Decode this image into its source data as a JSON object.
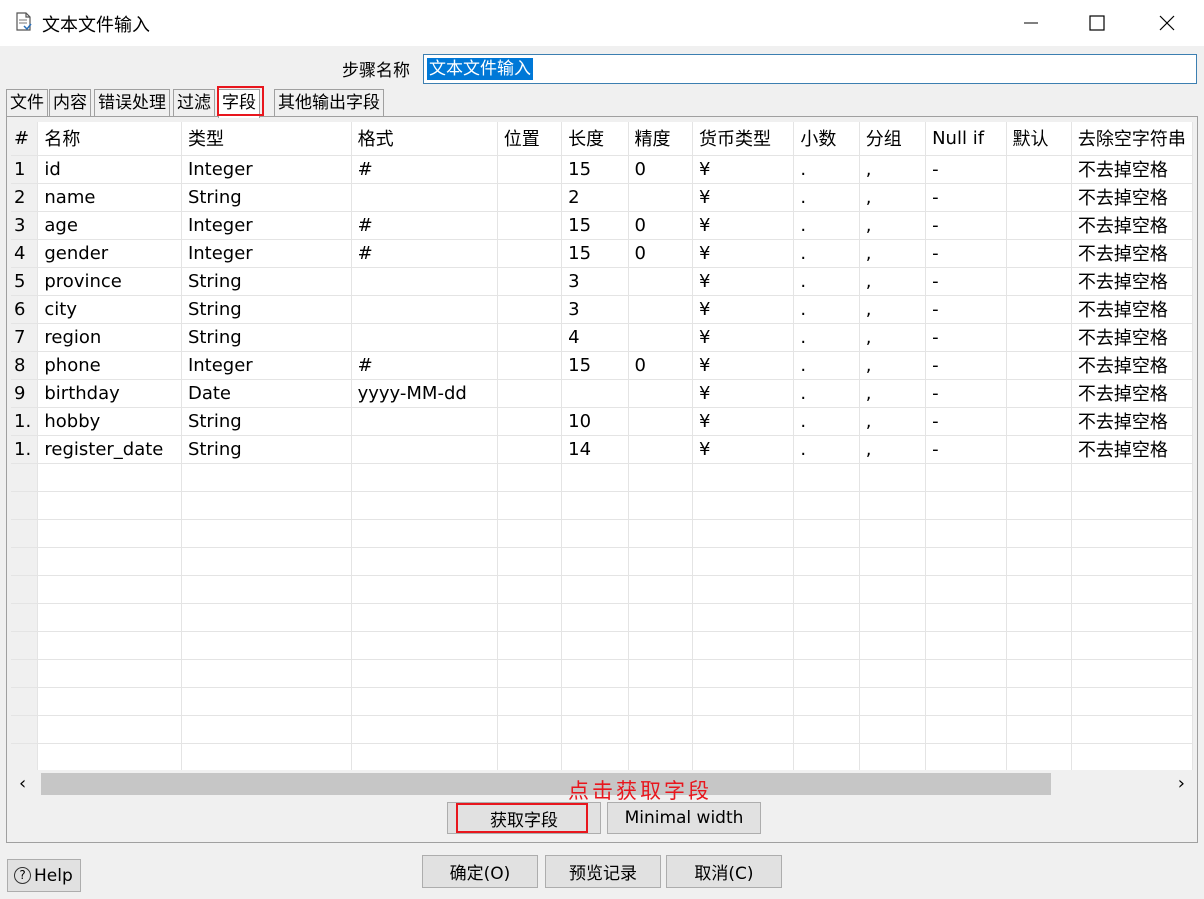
{
  "window": {
    "title": "文本文件输入"
  },
  "step": {
    "label": "步骤名称",
    "value": "文本文件输入"
  },
  "tabs": [
    {
      "label": "文件"
    },
    {
      "label": "内容"
    },
    {
      "label": "错误处理"
    },
    {
      "label": "过滤"
    },
    {
      "label": "字段"
    },
    {
      "label": "其他输出字段"
    }
  ],
  "active_tab": "字段",
  "grid": {
    "columns": [
      "#",
      "名称",
      "类型",
      "格式",
      "位置",
      "长度",
      "精度",
      "货币类型",
      "小数",
      "分组",
      "Null if",
      "默认",
      "去除空字符串"
    ],
    "rows": [
      [
        "1",
        "id",
        "Integer",
        "#",
        "",
        "15",
        "0",
        "¥",
        ".",
        ",",
        "-",
        "",
        "不去掉空格"
      ],
      [
        "2",
        "name",
        "String",
        "",
        "",
        "2",
        "",
        "¥",
        ".",
        ",",
        "-",
        "",
        "不去掉空格"
      ],
      [
        "3",
        "age",
        "Integer",
        "#",
        "",
        "15",
        "0",
        "¥",
        ".",
        ",",
        "-",
        "",
        "不去掉空格"
      ],
      [
        "4",
        "gender",
        "Integer",
        "#",
        "",
        "15",
        "0",
        "¥",
        ".",
        ",",
        "-",
        "",
        "不去掉空格"
      ],
      [
        "5",
        "province",
        "String",
        "",
        "",
        "3",
        "",
        "¥",
        ".",
        ",",
        "-",
        "",
        "不去掉空格"
      ],
      [
        "6",
        "city",
        "String",
        "",
        "",
        "3",
        "",
        "¥",
        ".",
        ",",
        "-",
        "",
        "不去掉空格"
      ],
      [
        "7",
        "region",
        "String",
        "",
        "",
        "4",
        "",
        "¥",
        ".",
        ",",
        "-",
        "",
        "不去掉空格"
      ],
      [
        "8",
        "phone",
        "Integer",
        "#",
        "",
        "15",
        "0",
        "¥",
        ".",
        ",",
        "-",
        "",
        "不去掉空格"
      ],
      [
        "9",
        "birthday",
        "Date",
        "yyyy-MM-dd",
        "",
        "",
        "",
        "¥",
        ".",
        ",",
        "-",
        "",
        "不去掉空格"
      ],
      [
        "1.",
        "hobby",
        "String",
        "",
        "",
        "10",
        "",
        "¥",
        ".",
        ",",
        "-",
        "",
        "不去掉空格"
      ],
      [
        "1.",
        "register_date",
        "String",
        "",
        "",
        "14",
        "",
        "¥",
        ".",
        ",",
        "-",
        "",
        "不去掉空格"
      ]
    ]
  },
  "annotation": "点击获取字段",
  "buttons": {
    "get_fields": "获取字段",
    "minimal_width": "Minimal width",
    "ok": "确定(O)",
    "preview": "预览记录",
    "cancel": "取消(C)",
    "help": "Help"
  },
  "colors": {
    "highlight": "#e8161d",
    "selection": "#0078d7"
  }
}
